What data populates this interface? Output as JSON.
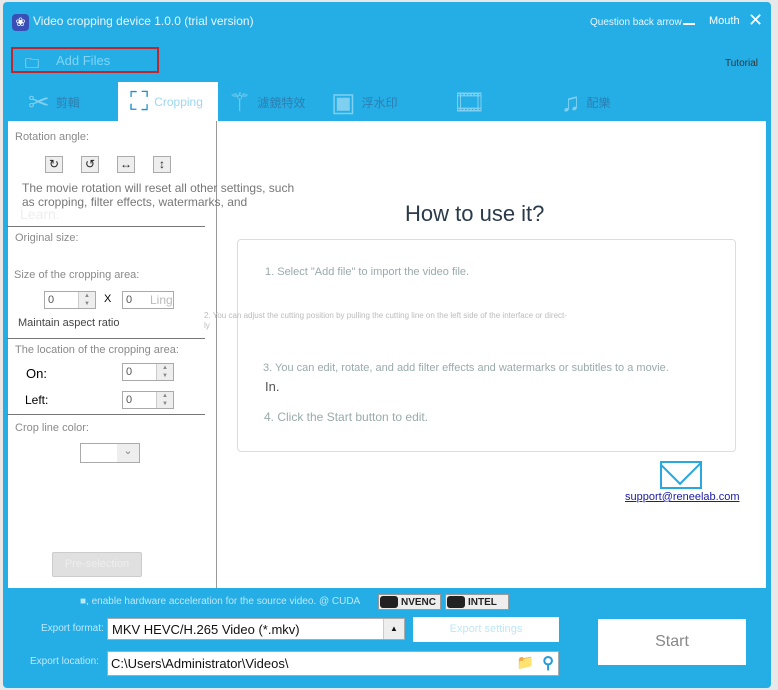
{
  "app": {
    "title": "Video cropping device 1.0.0 (trial version)",
    "question": "Question back arrow",
    "mouth": "Mouth",
    "tutorial": "Tutorial",
    "add_files": "Add Files"
  },
  "tabs": [
    {
      "label": "剪輯",
      "icon": "scissors-icon"
    },
    {
      "label": "Cropping",
      "icon": "crop-icon"
    },
    {
      "label": "濾鏡特效",
      "icon": "magic-wand-icon"
    },
    {
      "label": "浮水印",
      "icon": "watermark-icon"
    },
    {
      "label": "",
      "icon": "video-icon"
    },
    {
      "label": "配樂",
      "icon": "music-icon"
    }
  ],
  "left": {
    "rotation_label": "Rotation angle:",
    "rotation_note": "The movie rotation will reset all other settings, such as cropping, filter effects, watermarks, and",
    "learn": "Learn.",
    "original_size": "Original size:",
    "crop_size_label": "Size of the cropping area:",
    "width": "0",
    "x": "X",
    "height": "0",
    "ling": "Ling",
    "aspect": "Maintain aspect ratio",
    "location_label": "The location of the cropping area:",
    "on_label": "On:",
    "on_value": "0",
    "left_label": "Left:",
    "left_value": "0",
    "color_label": "Crop line color:",
    "preselection": "Pre-selection"
  },
  "main": {
    "title": "How to use it?",
    "steps": [
      "1. Select \"Add file\" to import the video file.",
      "2. You can adjust the cutting position by pulling the cutting line on the left side of the interface or direct-",
      "ly",
      "3. You can edit, rotate, and add filter effects and watermarks or subtitles to a movie.",
      "In.",
      "4. Click the Start button to edit."
    ],
    "email": "support@reneelab.com"
  },
  "bottom": {
    "hw_text": "■, enable hardware acceleration for the source video. @ CUDA",
    "nvenc": "NVENC",
    "intel": "INTEL",
    "format_label": "Export format:",
    "format_value": "MKV HEVC/H.265 Video (*.mkv)",
    "export_settings": "Export settings",
    "location_label": "Export location:",
    "location_value": "C:\\Users\\Administrator\\Videos\\",
    "start": "Start"
  },
  "colors": {
    "accent": "#25aee6",
    "highlight_border": "#c0262e"
  }
}
